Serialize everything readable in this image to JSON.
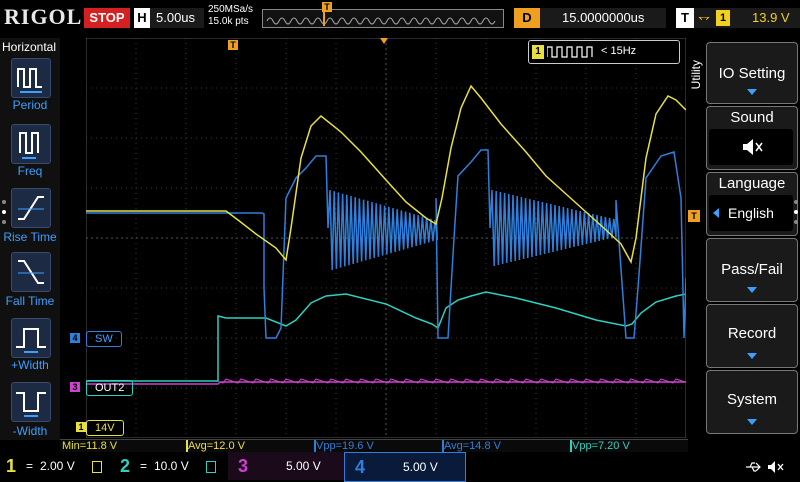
{
  "header": {
    "logo": "RIGOL",
    "run_state": "STOP",
    "horizontal_label": "H",
    "timebase": "5.00us",
    "sample_rate": "250MSa/s",
    "points": "15.0k pts",
    "delay_label": "D",
    "delay_value": "15.0000000us",
    "trigger_label": "T",
    "trigger_edge": "⥐",
    "trigger_source": "1",
    "trigger_level": "13.9 V"
  },
  "left_panel": {
    "title": "Horizontal",
    "items": [
      {
        "label": "Period",
        "icon": "period-icon"
      },
      {
        "label": "Freq",
        "icon": "freq-icon"
      },
      {
        "label": "Rise Time",
        "icon": "rise-time-icon"
      },
      {
        "label": "Fall Time",
        "icon": "fall-time-icon"
      },
      {
        "label": "+Width",
        "icon": "pos-width-icon"
      },
      {
        "label": "-Width",
        "icon": "neg-width-icon"
      }
    ]
  },
  "freq_counter": {
    "channel": "1",
    "text": "< 15Hz"
  },
  "channel_labels": {
    "ch4": {
      "marker": "4",
      "name": "SW",
      "color": "#2f7fdc"
    },
    "ch3": {
      "marker": "3",
      "name": "OUT2",
      "color": "#d040d0"
    },
    "ch1": {
      "marker": "1",
      "name": "14V",
      "color": "#e8e040"
    }
  },
  "trigger_marker": "T",
  "measurements": [
    {
      "text": "Min=11.8 V",
      "color": "#e8e040"
    },
    {
      "text": "Avg=12.0 V",
      "color": "#e8e040"
    },
    {
      "text": "Vpp=19.6 V",
      "color": "#2f7fdc"
    },
    {
      "text": "Avg=14.8 V",
      "color": "#2f7fdc"
    },
    {
      "text": "Vpp=7.20 V",
      "color": "#2fd0c0"
    }
  ],
  "menu": {
    "utility_label": "Utility",
    "items": [
      {
        "label": "IO Setting",
        "has_arrow": true
      },
      {
        "label": "Sound",
        "value_icon": "speaker-mute-icon"
      },
      {
        "label": "Language",
        "value": "English"
      },
      {
        "label": "Pass/Fail",
        "has_arrow": true
      },
      {
        "label": "Record",
        "has_arrow": true
      },
      {
        "label": "System",
        "has_arrow": true
      }
    ]
  },
  "bottom": {
    "channels": [
      {
        "num": "1",
        "coupling": "=",
        "scale": "2.00 V",
        "color": "#e8e040"
      },
      {
        "num": "2",
        "coupling": "=",
        "scale": "10.0 V",
        "color": "#2fd0c0"
      },
      {
        "num": "3",
        "coupling": "=",
        "scale": "5.00 V",
        "color": "#d040d0"
      },
      {
        "num": "4",
        "coupling": "=",
        "scale": "5.00 V",
        "color": "#2f7fdc"
      }
    ]
  },
  "colors": {
    "ch1": "#e8e040",
    "ch2": "#2fd0c0",
    "ch3": "#d040d0",
    "ch4": "#2f7fdc",
    "accent": "#3aa0ff",
    "trigger": "#f0a020"
  }
}
